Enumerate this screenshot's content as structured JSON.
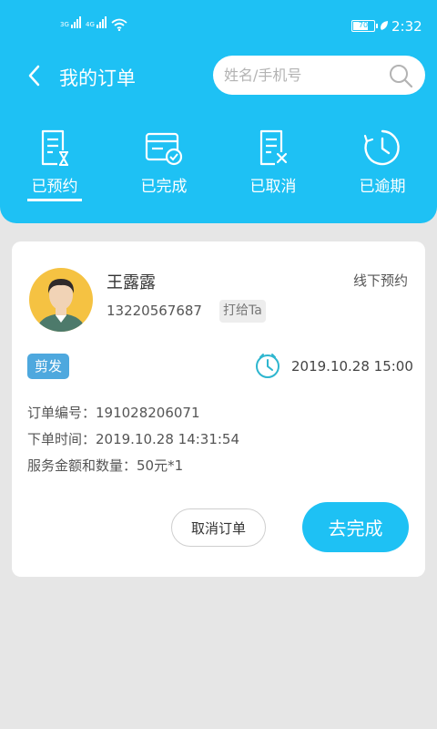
{
  "status_bar": {
    "sim1_label": "3G",
    "sim2_label": "4G",
    "battery": "70",
    "time": "2:32",
    "icons": [
      "signal-icon",
      "wifi-icon",
      "battery-icon",
      "leaf-icon"
    ]
  },
  "nav": {
    "title": "我的订单",
    "search_placeholder": "姓名/手机号",
    "icons": [
      "back-arrow-icon",
      "search-icon"
    ]
  },
  "tabs": [
    {
      "label": "已预约",
      "icon": "hourglass-doc-icon",
      "active": true
    },
    {
      "label": "已完成",
      "icon": "card-check-icon",
      "active": false
    },
    {
      "label": "已取消",
      "icon": "doc-x-icon",
      "active": false
    },
    {
      "label": "已逾期",
      "icon": "clock-icon",
      "active": false
    }
  ],
  "order": {
    "customer_name": "王露露",
    "order_type": "线下预约",
    "phone": "13220567687",
    "call_label": "打给Ta",
    "service_tag": "剪发",
    "appointment_time": "2019.10.28 15:00",
    "order_no": "订单编号：191028206071",
    "order_time": "下单时间：2019.10.28 14:31:54",
    "amount": "服务金额和数量：50元*1",
    "cancel_label": "取消订单",
    "complete_label": "去完成"
  },
  "colors": {
    "accent": "#1ec1f4",
    "tag": "#4ea8de",
    "background": "#e6e6e6"
  }
}
